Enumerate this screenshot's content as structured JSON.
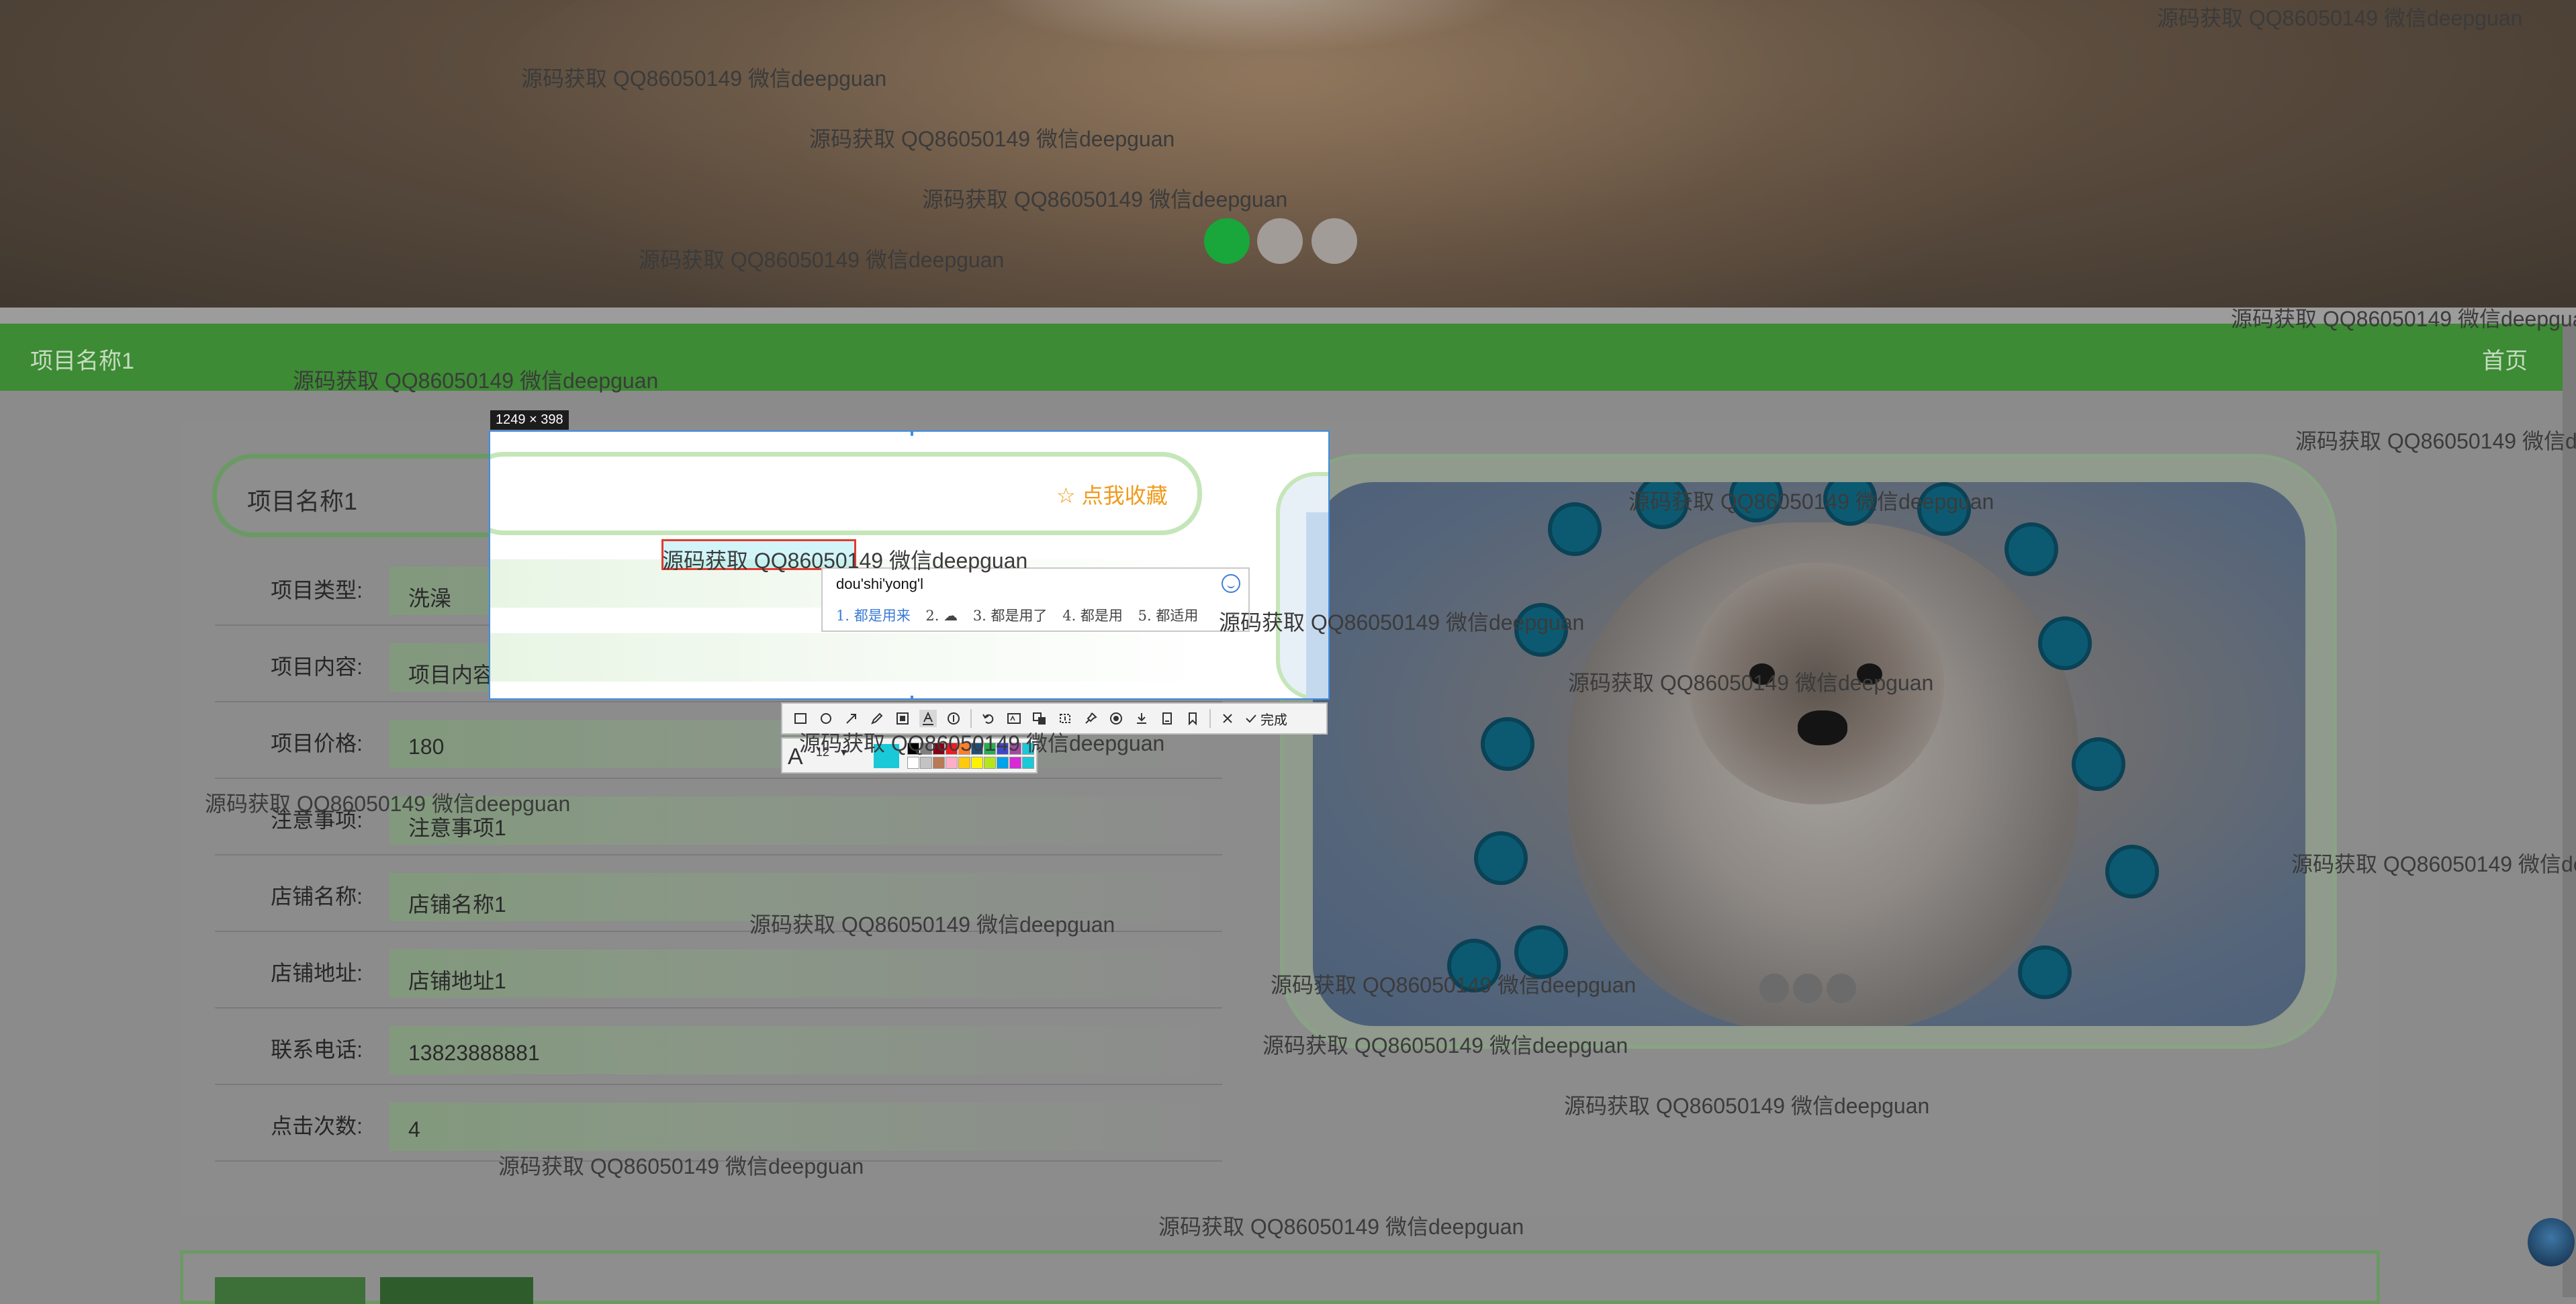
{
  "banner": {
    "carousel_dots": [
      {
        "state": "active",
        "color": "#19a63a"
      },
      {
        "state": "inactive"
      },
      {
        "state": "inactive"
      }
    ]
  },
  "navbar": {
    "brand": "项目名称1",
    "home_link": "首页",
    "color": "#3d8b34"
  },
  "detail": {
    "title": "项目名称1",
    "fields": [
      {
        "label": "项目类型:",
        "value": "洗澡"
      },
      {
        "label": "项目内容:",
        "value": "项目内容1"
      },
      {
        "label": "项目价格:",
        "value": "180"
      },
      {
        "label": "注意事项:",
        "value": "注意事项1"
      },
      {
        "label": "店铺名称:",
        "value": "店铺名称1"
      },
      {
        "label": "店铺地址:",
        "value": "店铺地址1"
      },
      {
        "label": "联系电话:",
        "value": "13823888881"
      },
      {
        "label": "点击次数:",
        "value": "4"
      }
    ]
  },
  "capture_overlay": {
    "size_label": "1249 × 398",
    "favorite_label": "☆ 点我收藏",
    "ime": {
      "input": "dou'shi'yong'l",
      "candidates": [
        "1. 都是用来",
        "2. ☁",
        "3. 都是用了",
        "4. 都是用",
        "5. 都适用"
      ]
    },
    "toolbar": {
      "tools": [
        "rectangle-icon",
        "ellipse-icon",
        "arrow-icon",
        "pen-icon",
        "mosaic-icon",
        "text-icon",
        "number-icon",
        "undo-icon",
        "ocr-icon",
        "translate-icon",
        "scroll-capture-icon",
        "pin-icon",
        "record-icon",
        "download-icon",
        "save-icon",
        "bookmark-icon"
      ],
      "close_icon": "close-icon",
      "done_label": "完成",
      "font_size": "12",
      "current_color": "#19c9d7",
      "palette": [
        "#000000",
        "#7f7f7f",
        "#880015",
        "#ed1c24",
        "#ff7f27",
        "#1f4e78",
        "#22b14c",
        "#3f48cc",
        "#a349a4",
        "#19c9d7",
        "#ffffff",
        "#c3c3c3",
        "#b97a57",
        "#ffaec9",
        "#ffc90e",
        "#fff200",
        "#b5e61d",
        "#00a2e8",
        "#d62ad6",
        "#19c9d7"
      ]
    }
  },
  "watermark_text": "源码获取 QQ86050149 微信deepguan"
}
